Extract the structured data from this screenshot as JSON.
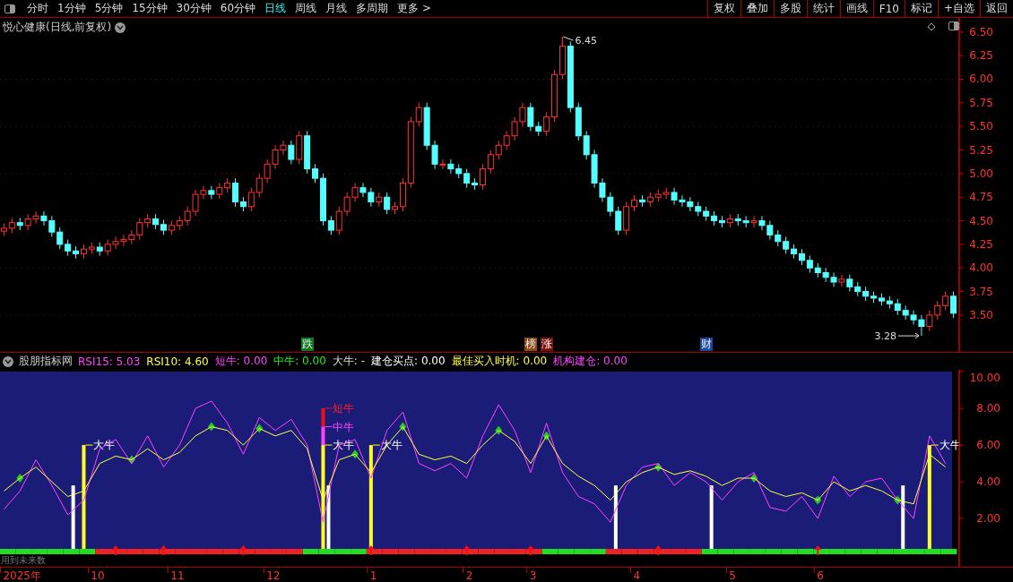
{
  "toolbar": {
    "tabs": [
      {
        "label": "分时",
        "selected": false
      },
      {
        "label": "1分钟",
        "selected": false
      },
      {
        "label": "5分钟",
        "selected": false
      },
      {
        "label": "15分钟",
        "selected": false
      },
      {
        "label": "30分钟",
        "selected": false
      },
      {
        "label": "60分钟",
        "selected": false
      },
      {
        "label": "日线",
        "selected": true
      },
      {
        "label": "周线",
        "selected": false
      },
      {
        "label": "月线",
        "selected": false
      },
      {
        "label": "多周期",
        "selected": false
      },
      {
        "label": "更多 >",
        "selected": false
      }
    ],
    "buttons": [
      "复权",
      "叠加",
      "多股",
      "统计",
      "画线",
      "F10",
      "标记",
      "+自选",
      "返回"
    ]
  },
  "price_chart": {
    "title": "悦心健康(日线,前复权)",
    "chart_data": {
      "type": "candlestick",
      "grid": true,
      "ohlc": [
        [
          4.39,
          4.47,
          4.34,
          4.42
        ],
        [
          4.42,
          4.53,
          4.37,
          4.48
        ],
        [
          4.48,
          4.53,
          4.4,
          4.45
        ],
        [
          4.45,
          4.57,
          4.4,
          4.52
        ],
        [
          4.52,
          4.6,
          4.47,
          4.55
        ],
        [
          4.55,
          4.6,
          4.45,
          4.5
        ],
        [
          4.5,
          4.55,
          4.33,
          4.38
        ],
        [
          4.38,
          4.43,
          4.2,
          4.25
        ],
        [
          4.25,
          4.3,
          4.13,
          4.18
        ],
        [
          4.18,
          4.23,
          4.1,
          4.15
        ],
        [
          4.15,
          4.25,
          4.1,
          4.2
        ],
        [
          4.2,
          4.27,
          4.15,
          4.22
        ],
        [
          4.22,
          4.27,
          4.13,
          4.18
        ],
        [
          4.18,
          4.3,
          4.13,
          4.25
        ],
        [
          4.25,
          4.33,
          4.2,
          4.28
        ],
        [
          4.28,
          4.35,
          4.23,
          4.3
        ],
        [
          4.3,
          4.4,
          4.25,
          4.35
        ],
        [
          4.35,
          4.53,
          4.3,
          4.48
        ],
        [
          4.48,
          4.57,
          4.43,
          4.52
        ],
        [
          4.52,
          4.57,
          4.41,
          4.46
        ],
        [
          4.46,
          4.51,
          4.35,
          4.4
        ],
        [
          4.4,
          4.5,
          4.35,
          4.45
        ],
        [
          4.45,
          4.55,
          4.4,
          4.5
        ],
        [
          4.5,
          4.65,
          4.45,
          4.6
        ],
        [
          4.6,
          4.83,
          4.55,
          4.78
        ],
        [
          4.78,
          4.87,
          4.73,
          4.82
        ],
        [
          4.82,
          4.87,
          4.73,
          4.78
        ],
        [
          4.78,
          4.9,
          4.73,
          4.85
        ],
        [
          4.85,
          4.95,
          4.8,
          4.9
        ],
        [
          4.9,
          4.95,
          4.65,
          4.7
        ],
        [
          4.7,
          4.75,
          4.6,
          4.65
        ],
        [
          4.65,
          4.85,
          4.6,
          4.8
        ],
        [
          4.8,
          5.0,
          4.75,
          4.95
        ],
        [
          4.95,
          5.15,
          4.9,
          5.1
        ],
        [
          5.1,
          5.3,
          5.05,
          5.25
        ],
        [
          5.25,
          5.35,
          5.2,
          5.3
        ],
        [
          5.3,
          5.35,
          5.1,
          5.15
        ],
        [
          5.15,
          5.45,
          5.1,
          5.4
        ],
        [
          5.4,
          5.45,
          5.0,
          5.05
        ],
        [
          5.05,
          5.1,
          4.9,
          4.95
        ],
        [
          4.95,
          5.0,
          4.45,
          4.5
        ],
        [
          4.5,
          4.55,
          4.35,
          4.4
        ],
        [
          4.4,
          4.65,
          4.35,
          4.6
        ],
        [
          4.6,
          4.8,
          4.55,
          4.75
        ],
        [
          4.75,
          4.9,
          4.7,
          4.85
        ],
        [
          4.85,
          4.9,
          4.75,
          4.8
        ],
        [
          4.8,
          4.85,
          4.65,
          4.7
        ],
        [
          4.7,
          4.8,
          4.65,
          4.75
        ],
        [
          4.75,
          4.8,
          4.57,
          4.62
        ],
        [
          4.62,
          4.7,
          4.57,
          4.65
        ],
        [
          4.65,
          4.95,
          4.6,
          4.9
        ],
        [
          4.9,
          5.6,
          4.85,
          5.55
        ],
        [
          5.55,
          5.75,
          5.5,
          5.7
        ],
        [
          5.7,
          5.75,
          5.25,
          5.3
        ],
        [
          5.3,
          5.35,
          5.05,
          5.1
        ],
        [
          5.1,
          5.15,
          5.05,
          5.1
        ],
        [
          5.1,
          5.15,
          5.0,
          5.05
        ],
        [
          5.05,
          5.1,
          4.95,
          5.0
        ],
        [
          5.0,
          5.05,
          4.85,
          4.9
        ],
        [
          4.9,
          4.95,
          4.83,
          4.88
        ],
        [
          4.88,
          5.1,
          4.83,
          5.05
        ],
        [
          5.05,
          5.25,
          5.0,
          5.2
        ],
        [
          5.2,
          5.35,
          5.15,
          5.3
        ],
        [
          5.3,
          5.45,
          5.25,
          5.4
        ],
        [
          5.4,
          5.6,
          5.35,
          5.55
        ],
        [
          5.55,
          5.75,
          5.5,
          5.7
        ],
        [
          5.7,
          5.75,
          5.45,
          5.5
        ],
        [
          5.5,
          5.55,
          5.4,
          5.45
        ],
        [
          5.45,
          5.65,
          5.4,
          5.6
        ],
        [
          5.6,
          6.1,
          5.55,
          6.05
        ],
        [
          6.05,
          6.45,
          6.0,
          6.35
        ],
        [
          6.35,
          6.4,
          5.65,
          5.7
        ],
        [
          5.7,
          5.75,
          5.35,
          5.4
        ],
        [
          5.4,
          5.45,
          5.15,
          5.2
        ],
        [
          5.2,
          5.25,
          4.85,
          4.9
        ],
        [
          4.9,
          4.95,
          4.7,
          4.75
        ],
        [
          4.75,
          4.8,
          4.55,
          4.6
        ],
        [
          4.6,
          4.65,
          4.35,
          4.4
        ],
        [
          4.4,
          4.7,
          4.35,
          4.65
        ],
        [
          4.65,
          4.77,
          4.6,
          4.72
        ],
        [
          4.72,
          4.77,
          4.65,
          4.7
        ],
        [
          4.7,
          4.8,
          4.65,
          4.75
        ],
        [
          4.75,
          4.83,
          4.7,
          4.78
        ],
        [
          4.78,
          4.85,
          4.73,
          4.8
        ],
        [
          4.8,
          4.85,
          4.67,
          4.72
        ],
        [
          4.72,
          4.77,
          4.65,
          4.7
        ],
        [
          4.7,
          4.75,
          4.6,
          4.65
        ],
        [
          4.65,
          4.7,
          4.55,
          4.6
        ],
        [
          4.6,
          4.65,
          4.5,
          4.55
        ],
        [
          4.55,
          4.6,
          4.45,
          4.5
        ],
        [
          4.5,
          4.55,
          4.43,
          4.48
        ],
        [
          4.48,
          4.57,
          4.43,
          4.52
        ],
        [
          4.52,
          4.57,
          4.45,
          4.5
        ],
        [
          4.5,
          4.55,
          4.43,
          4.48
        ],
        [
          4.48,
          4.55,
          4.43,
          4.5
        ],
        [
          4.5,
          4.55,
          4.4,
          4.45
        ],
        [
          4.45,
          4.5,
          4.3,
          4.35
        ],
        [
          4.35,
          4.4,
          4.23,
          4.28
        ],
        [
          4.28,
          4.33,
          4.15,
          4.2
        ],
        [
          4.2,
          4.25,
          4.1,
          4.15
        ],
        [
          4.15,
          4.2,
          4.03,
          4.08
        ],
        [
          4.08,
          4.13,
          3.95,
          4.0
        ],
        [
          4.0,
          4.05,
          3.9,
          3.95
        ],
        [
          3.95,
          4.0,
          3.85,
          3.9
        ],
        [
          3.9,
          3.95,
          3.8,
          3.85
        ],
        [
          3.85,
          3.93,
          3.8,
          3.88
        ],
        [
          3.88,
          3.93,
          3.75,
          3.8
        ],
        [
          3.8,
          3.85,
          3.7,
          3.75
        ],
        [
          3.75,
          3.8,
          3.65,
          3.7
        ],
        [
          3.7,
          3.75,
          3.63,
          3.68
        ],
        [
          3.68,
          3.73,
          3.6,
          3.65
        ],
        [
          3.65,
          3.7,
          3.57,
          3.62
        ],
        [
          3.62,
          3.67,
          3.5,
          3.55
        ],
        [
          3.55,
          3.6,
          3.45,
          3.5
        ],
        [
          3.5,
          3.55,
          3.4,
          3.45
        ],
        [
          3.45,
          3.5,
          3.28,
          3.38
        ],
        [
          3.38,
          3.55,
          3.33,
          3.5
        ],
        [
          3.5,
          3.65,
          3.45,
          3.6
        ],
        [
          3.6,
          3.75,
          3.55,
          3.7
        ],
        [
          3.7,
          3.75,
          3.47,
          3.52
        ]
      ],
      "ylim": [
        3.11,
        6.65
      ],
      "yticks": [
        {
          "value": 6.5,
          "label": "6.50"
        },
        {
          "value": 6.25,
          "label": "6.25"
        },
        {
          "value": 6,
          "label": "6.00"
        },
        {
          "value": 5.75,
          "label": "5.75"
        },
        {
          "value": 5.5,
          "label": "5.50"
        },
        {
          "value": 5.25,
          "label": "5.25"
        },
        {
          "value": 5,
          "label": "5.00"
        },
        {
          "value": 4.75,
          "label": "4.75"
        },
        {
          "value": 4.5,
          "label": "4.50"
        },
        {
          "value": 4.25,
          "label": "4.25"
        },
        {
          "value": 4,
          "label": "4.00"
        },
        {
          "value": 3.75,
          "label": "3.75"
        },
        {
          "value": 3.5,
          "label": "3.50"
        }
      ],
      "annotations": [
        {
          "text": "6.45"
        },
        {
          "text": "3.28"
        }
      ]
    }
  },
  "indicator": {
    "name": "股朋指标网",
    "legend": [
      {
        "label": "RSI15: 5.03",
        "color": "#ff44ff"
      },
      {
        "label": "RSI10: 4.60",
        "color": "#ffff44"
      },
      {
        "label": "短牛: 0.00",
        "color": "#ff44ff"
      },
      {
        "label": "中牛: 0.00",
        "color": "#22ee22"
      },
      {
        "label": "大牛: -"
      },
      {
        "label": "建仓买点: 0.00",
        "color": "#ffffff"
      },
      {
        "label": "最佳买入时机: 0.00",
        "color": "#ffff44"
      },
      {
        "label": "机构建仓: 0.00",
        "color": "#ff44ff"
      }
    ],
    "chart_data": {
      "type": "line",
      "ylim": [
        -0.63,
        10.1
      ],
      "yticks": [
        {
          "value": 10,
          "label": "10.00"
        },
        {
          "value": 8,
          "label": "8.00"
        },
        {
          "value": 6,
          "label": "6.00"
        },
        {
          "value": 4,
          "label": "4.00"
        },
        {
          "value": 2,
          "label": "2.00"
        }
      ],
      "series": [
        {
          "color": "#ff44ff",
          "values": [
            2.5,
            3.5,
            5.2,
            3.8,
            2.2,
            3.0,
            5.8,
            6.3,
            5.0,
            6.5,
            4.8,
            6.0,
            8.0,
            8.4,
            7.2,
            5.5,
            7.5,
            6.8,
            7.4,
            6.0,
            1.8,
            6.0,
            6.3,
            4.2,
            6.8,
            7.8,
            5.0,
            4.6,
            5.0,
            4.2,
            6.5,
            8.2,
            6.8,
            4.5,
            7.2,
            4.5,
            3.2,
            2.8,
            1.8,
            3.8,
            4.8,
            5.0,
            3.8,
            4.5,
            4.0,
            3.0,
            4.0,
            4.5,
            2.6,
            2.4,
            3.2,
            2.0,
            4.3,
            3.2,
            4.0,
            4.2,
            3.0,
            2.0,
            6.5,
            5.0
          ]
        },
        {
          "color": "#ffff44",
          "values": [
            3.5,
            4.2,
            4.8,
            4.0,
            3.2,
            3.5,
            5.0,
            5.4,
            5.2,
            5.8,
            5.2,
            5.6,
            6.5,
            7.0,
            6.8,
            6.0,
            6.9,
            6.5,
            6.8,
            5.8,
            3.0,
            5.2,
            5.5,
            4.5,
            6.0,
            7.0,
            5.5,
            5.2,
            5.4,
            5.0,
            6.0,
            6.8,
            6.2,
            5.0,
            6.5,
            5.0,
            4.3,
            3.8,
            3.0,
            4.0,
            4.5,
            4.8,
            4.4,
            4.6,
            4.3,
            3.8,
            4.2,
            4.2,
            3.5,
            3.2,
            3.4,
            3.0,
            4.0,
            3.5,
            3.8,
            3.5,
            3.0,
            2.8,
            5.5,
            4.8
          ]
        }
      ]
    },
    "note": "用到未来数"
  },
  "days": [
    {
      "color": "#22dd22",
      "arrow": false,
      "mark": false
    },
    {
      "color": "#22dd22",
      "arrow": false,
      "mark": true
    },
    {
      "color": "#22dd22",
      "arrow": false,
      "mark": false
    },
    {
      "color": "#22dd22",
      "arrow": false,
      "mark": false
    },
    {
      "color": "#22dd22",
      "arrow": false,
      "mark": false,
      "signals": [
        {
          "kind": "entry"
        }
      ]
    },
    {
      "color": "#22dd22",
      "arrow": false,
      "mark": false,
      "signals": [
        {
          "kind": "big",
          "label": "大牛"
        }
      ]
    },
    {
      "color": "#ee2222",
      "arrow": false,
      "mark": false
    },
    {
      "color": "#ee2222",
      "arrow": true,
      "mark": false
    },
    {
      "color": "#ee2222",
      "arrow": false,
      "mark": true
    },
    {
      "color": "#ee2222",
      "arrow": false,
      "mark": false
    },
    {
      "color": "#ee2222",
      "arrow": true,
      "mark": false
    },
    {
      "color": "#ee2222",
      "arrow": false,
      "mark": false
    },
    {
      "color": "#ee2222",
      "arrow": false,
      "mark": false
    },
    {
      "color": "#ee2222",
      "arrow": false,
      "mark": true
    },
    {
      "color": "#ee2222",
      "arrow": false,
      "mark": false
    },
    {
      "color": "#ee2222",
      "arrow": true,
      "mark": false
    },
    {
      "color": "#ee2222",
      "arrow": false,
      "mark": true
    },
    {
      "color": "#ee2222",
      "arrow": false,
      "mark": false
    },
    {
      "color": "#ee2222",
      "arrow": false,
      "mark": false
    },
    {
      "color": "#22dd22",
      "arrow": false,
      "mark": false,
      "event": {
        "label": "跌",
        "color": "#0b7a1e"
      }
    },
    {
      "color": "#22dd22",
      "arrow": false,
      "mark": false,
      "signals": [
        {
          "kind": "short",
          "label": "短牛"
        },
        {
          "kind": "mid",
          "label": "中牛"
        },
        {
          "kind": "big",
          "label": "大牛"
        },
        {
          "kind": "entry"
        }
      ]
    },
    {
      "color": "#22dd22",
      "arrow": false,
      "mark": false
    },
    {
      "color": "#22dd22",
      "arrow": false,
      "mark": true
    },
    {
      "color": "#ee2222",
      "arrow": true,
      "mark": false,
      "signals": [
        {
          "kind": "big",
          "label": "大牛"
        }
      ]
    },
    {
      "color": "#ee2222",
      "arrow": false,
      "mark": false
    },
    {
      "color": "#ee2222",
      "arrow": false,
      "mark": true
    },
    {
      "color": "#ee2222",
      "arrow": false,
      "mark": false
    },
    {
      "color": "#ee2222",
      "arrow": false,
      "mark": false
    },
    {
      "color": "#ee2222",
      "arrow": false,
      "mark": false
    },
    {
      "color": "#ee2222",
      "arrow": true,
      "mark": false
    },
    {
      "color": "#ee2222",
      "arrow": false,
      "mark": false
    },
    {
      "color": "#ee2222",
      "arrow": false,
      "mark": true
    },
    {
      "color": "#ee2222",
      "arrow": false,
      "mark": false
    },
    {
      "color": "#ee2222",
      "arrow": true,
      "mark": false,
      "event": {
        "label": "榜",
        "color": "#8a4a14"
      }
    },
    {
      "color": "#22dd22",
      "arrow": false,
      "mark": true,
      "event": {
        "label": "涨",
        "color": "#7a1010"
      }
    },
    {
      "color": "#22dd22",
      "arrow": false,
      "mark": false
    },
    {
      "color": "#22dd22",
      "arrow": false,
      "mark": false
    },
    {
      "color": "#22dd22",
      "arrow": false,
      "mark": false
    },
    {
      "color": "#ee2222",
      "arrow": false,
      "mark": false,
      "signals": [
        {
          "kind": "entry"
        }
      ]
    },
    {
      "color": "#ee2222",
      "arrow": false,
      "mark": false
    },
    {
      "color": "#ee2222",
      "arrow": false,
      "mark": false
    },
    {
      "color": "#ee2222",
      "arrow": true,
      "mark": true
    },
    {
      "color": "#ee2222",
      "arrow": false,
      "mark": false
    },
    {
      "color": "#ee2222",
      "arrow": false,
      "mark": false
    },
    {
      "color": "#22dd22",
      "arrow": false,
      "mark": false,
      "event": {
        "label": "财",
        "color": "#1a4aa0"
      },
      "signals": [
        {
          "kind": "entry"
        }
      ]
    },
    {
      "color": "#22dd22",
      "arrow": false,
      "mark": false
    },
    {
      "color": "#22dd22",
      "arrow": false,
      "mark": false
    },
    {
      "color": "#22dd22",
      "arrow": false,
      "mark": true
    },
    {
      "color": "#22dd22",
      "arrow": false,
      "mark": false
    },
    {
      "color": "#22dd22",
      "arrow": false,
      "mark": false
    },
    {
      "color": "#22dd22",
      "arrow": false,
      "mark": false
    },
    {
      "color": "#22dd22",
      "arrow": true,
      "mark": true
    },
    {
      "color": "#22dd22",
      "arrow": false,
      "mark": false
    },
    {
      "color": "#22dd22",
      "arrow": false,
      "mark": false
    },
    {
      "color": "#22dd22",
      "arrow": false,
      "mark": false
    },
    {
      "color": "#22dd22",
      "arrow": false,
      "mark": false
    },
    {
      "color": "#22dd22",
      "arrow": false,
      "mark": true,
      "signals": [
        {
          "kind": "entry"
        }
      ]
    },
    {
      "color": "#22dd22",
      "arrow": false,
      "mark": false
    },
    {
      "color": "#22dd22",
      "arrow": false,
      "mark": false,
      "signals": [
        {
          "kind": "big",
          "label": "大牛"
        }
      ]
    },
    {
      "color": "#22dd22",
      "arrow": false,
      "mark": false
    }
  ],
  "date_axis": [
    "2025年",
    "10",
    "11",
    "12",
    "1",
    "2",
    "3",
    "4",
    "5",
    "6"
  ]
}
